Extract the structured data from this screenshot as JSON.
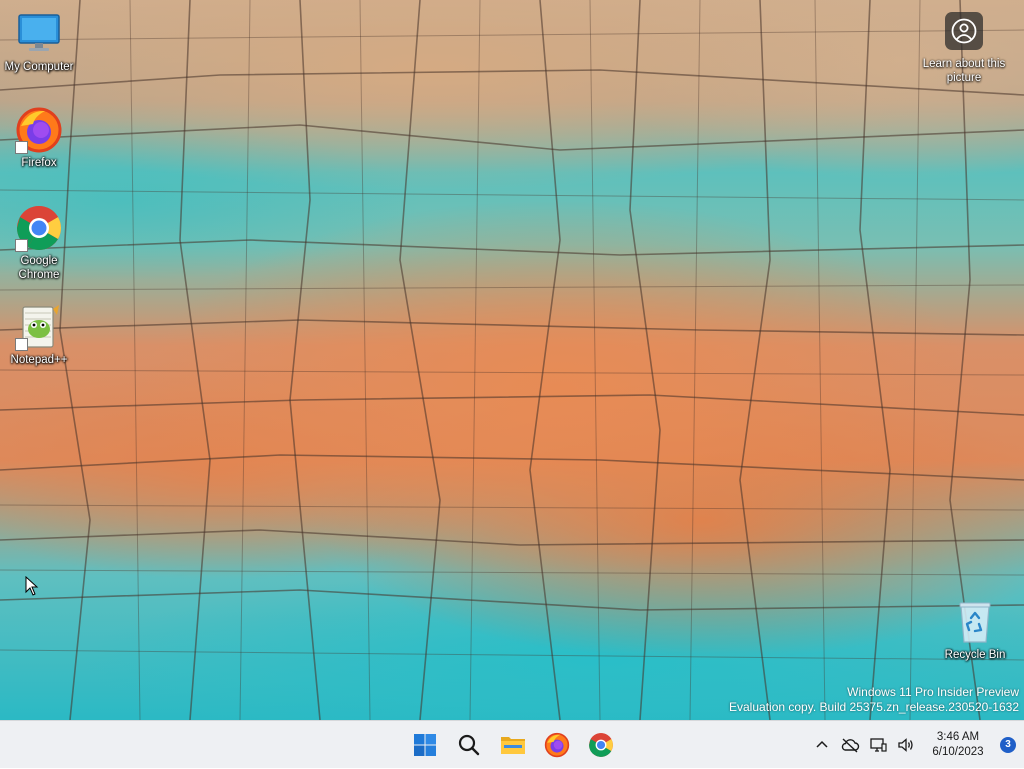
{
  "desktop": {
    "icons": [
      {
        "label": "My Computer",
        "icon": "monitor-icon"
      },
      {
        "label": "Firefox",
        "icon": "firefox-icon"
      },
      {
        "label": "Google Chrome",
        "icon": "chrome-icon"
      },
      {
        "label": "Notepad++",
        "icon": "notepadpp-icon"
      },
      {
        "label": "Recycle Bin",
        "icon": "recycle-bin-icon"
      }
    ],
    "learn_label": "Learn about this picture",
    "watermark": {
      "line1": "Windows 11 Pro Insider Preview",
      "line2": "Evaluation copy. Build 25375.zn_release.230520-1632"
    }
  },
  "taskbar": {
    "pinned": [
      {
        "name": "start",
        "icon": "windows-logo-icon"
      },
      {
        "name": "search",
        "icon": "search-icon"
      },
      {
        "name": "file-explorer",
        "icon": "folder-icon"
      },
      {
        "name": "firefox",
        "icon": "firefox-icon"
      },
      {
        "name": "chrome",
        "icon": "chrome-icon"
      }
    ],
    "tray": {
      "time": "3:46 AM",
      "date": "6/10/2023",
      "notification_count": "3"
    }
  },
  "colors": {
    "taskbar_bg": "#eef0f3",
    "accent": "#1f5fc8",
    "water": "#2bb9c4",
    "rock": "#dd8a5c"
  }
}
